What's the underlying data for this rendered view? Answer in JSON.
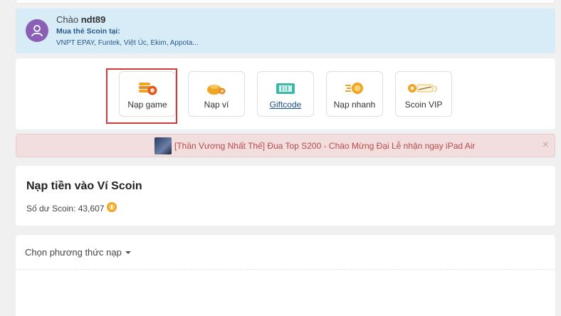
{
  "greeting": {
    "hello_prefix": "Chào",
    "username": "ndt89",
    "buy_label": "Mua thẻ Scoin tại:",
    "shops": "VNPT EPAY, Funtek, Việt Úc, Ekim, Appota..."
  },
  "actions": [
    {
      "label": "Nạp game",
      "icon": "coin-stack-icon"
    },
    {
      "label": "Nạp ví",
      "icon": "wallet-coins-icon"
    },
    {
      "label": "Giftcode",
      "icon": "ticket-icon"
    },
    {
      "label": "Nạp nhanh",
      "icon": "fast-coin-icon"
    },
    {
      "label": "Scoin VIP",
      "icon": "scoin-vip-icon"
    }
  ],
  "notice": {
    "message": "[Thần Vương Nhất Thế] Đua Top S200 - Chào Mừng Đại Lễ nhận ngay iPad Air",
    "close": "×"
  },
  "balance": {
    "title": "Nạp tiền vào Ví Scoin",
    "label": "Số dư Scoin:",
    "amount": "43,607"
  },
  "method": {
    "select_label": "Chọn phương thức nạp"
  },
  "colors": {
    "highlight": "#d43a3a",
    "coin": "#f0a422",
    "notice_text": "#b94a48",
    "link": "#1a4f8a"
  }
}
